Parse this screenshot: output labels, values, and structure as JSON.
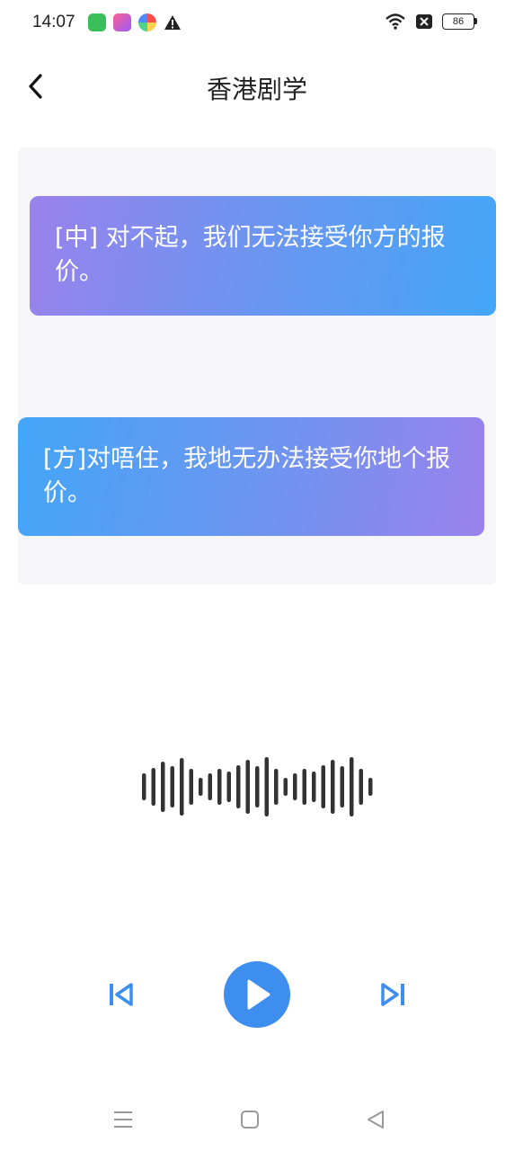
{
  "status_bar": {
    "time": "14:07",
    "battery_level": "86"
  },
  "header": {
    "title": "香港剧学"
  },
  "dialog": {
    "mandarin_text": "[中] 对不起，我们无法接受你方的报价。",
    "cantonese_text": "[方]对唔住，我地无办法接受你地个报价。"
  },
  "colors": {
    "accent": "#3e8ef0",
    "bubble_blue": "#43a6f8",
    "bubble_purple": "#9a82ec",
    "waveform": "#333333"
  },
  "icons": {
    "back": "chevron-left-icon",
    "prev": "skip-previous-icon",
    "play": "play-icon",
    "next": "skip-next-icon",
    "nav_menu": "menu-icon",
    "nav_home": "home-square-icon",
    "nav_back": "triangle-back-icon"
  }
}
